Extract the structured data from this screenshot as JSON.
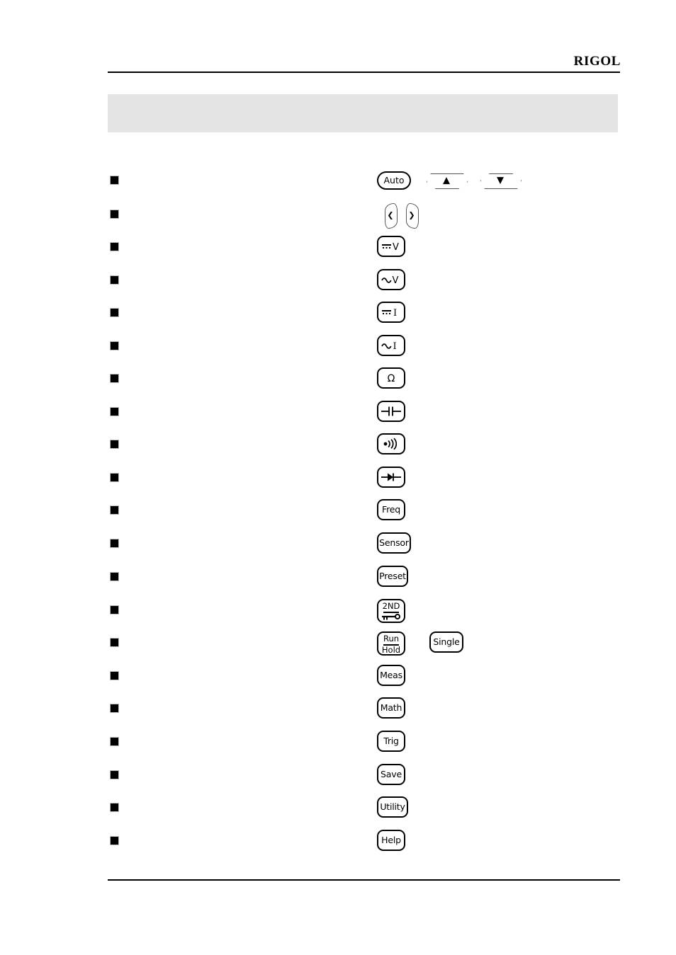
{
  "page": {
    "brand": "RIGOL",
    "heading": "",
    "background_color": "#ffffff",
    "rule_color": "#000000",
    "heading_band_color": "#e4e4e4",
    "bullet_glyph": "■"
  },
  "list": {
    "items": [
      {
        "text": "",
        "keys": [
          {
            "type": "pill",
            "label": "Auto",
            "name": "auto-key"
          },
          {
            "type": "trapz-up",
            "label": "▲",
            "name": "up-arrow-key"
          },
          {
            "type": "trapz-down",
            "label": "▼",
            "name": "down-arrow-key"
          }
        ]
      },
      {
        "text": "",
        "keys": [
          {
            "type": "lens-left",
            "label": "❮",
            "name": "left-arrow-key"
          },
          {
            "type": "lens-right",
            "label": "❯",
            "name": "right-arrow-key"
          }
        ]
      },
      {
        "text": "",
        "keys": [
          {
            "type": "sym",
            "symbol": "dcv",
            "label": "DCV",
            "name": "dc-voltage-key"
          }
        ]
      },
      {
        "text": "",
        "keys": [
          {
            "type": "sym",
            "symbol": "acv",
            "label": "ACV",
            "name": "ac-voltage-key"
          }
        ]
      },
      {
        "text": "",
        "keys": [
          {
            "type": "sym",
            "symbol": "dci",
            "label": "DCI",
            "name": "dc-current-key"
          }
        ]
      },
      {
        "text": "",
        "keys": [
          {
            "type": "sym",
            "symbol": "aci",
            "label": "ACI",
            "name": "ac-current-key"
          }
        ]
      },
      {
        "text": "",
        "keys": [
          {
            "type": "sym",
            "symbol": "ohm",
            "label": "Ω",
            "name": "resistance-key"
          }
        ]
      },
      {
        "text": "",
        "keys": [
          {
            "type": "sym",
            "symbol": "cap",
            "label": "Capacitance",
            "name": "capacitance-key"
          }
        ]
      },
      {
        "text": "",
        "keys": [
          {
            "type": "sym",
            "symbol": "cont",
            "label": "Continuity",
            "name": "continuity-key"
          }
        ]
      },
      {
        "text": "",
        "keys": [
          {
            "type": "sym",
            "symbol": "diode",
            "label": "Diode",
            "name": "diode-key"
          }
        ]
      },
      {
        "text": "",
        "keys": [
          {
            "type": "rect",
            "label": "Freq",
            "name": "freq-key"
          }
        ]
      },
      {
        "text": "",
        "keys": [
          {
            "type": "rect",
            "label": "Sensor",
            "name": "sensor-key",
            "width": "xwide"
          }
        ]
      },
      {
        "text": "",
        "keys": [
          {
            "type": "rect",
            "label": "Preset",
            "name": "preset-key",
            "width": "wide"
          }
        ]
      },
      {
        "text": "",
        "keys": [
          {
            "type": "second",
            "label": "2ND",
            "name": "second-function-key"
          }
        ]
      },
      {
        "text": "",
        "keys": [
          {
            "type": "stack",
            "line1": "Run",
            "line2": "Hold",
            "label": "Run/Hold",
            "name": "run-hold-key"
          },
          {
            "type": "rect",
            "label": "Single",
            "name": "single-key",
            "width": "xwide"
          }
        ]
      },
      {
        "text": "",
        "keys": [
          {
            "type": "rect",
            "label": "Meas",
            "name": "meas-key"
          }
        ]
      },
      {
        "text": "",
        "keys": [
          {
            "type": "rect",
            "label": "Math",
            "name": "math-key"
          }
        ]
      },
      {
        "text": "",
        "keys": [
          {
            "type": "rect",
            "label": "Trig",
            "name": "trig-key"
          }
        ]
      },
      {
        "text": "",
        "keys": [
          {
            "type": "rect",
            "label": "Save",
            "name": "save-key"
          }
        ]
      },
      {
        "text": "",
        "keys": [
          {
            "type": "rect",
            "label": "Utility",
            "name": "utility-key",
            "width": "wide"
          }
        ]
      },
      {
        "text": "",
        "keys": [
          {
            "type": "rect",
            "label": "Help",
            "name": "help-key"
          }
        ]
      }
    ]
  }
}
